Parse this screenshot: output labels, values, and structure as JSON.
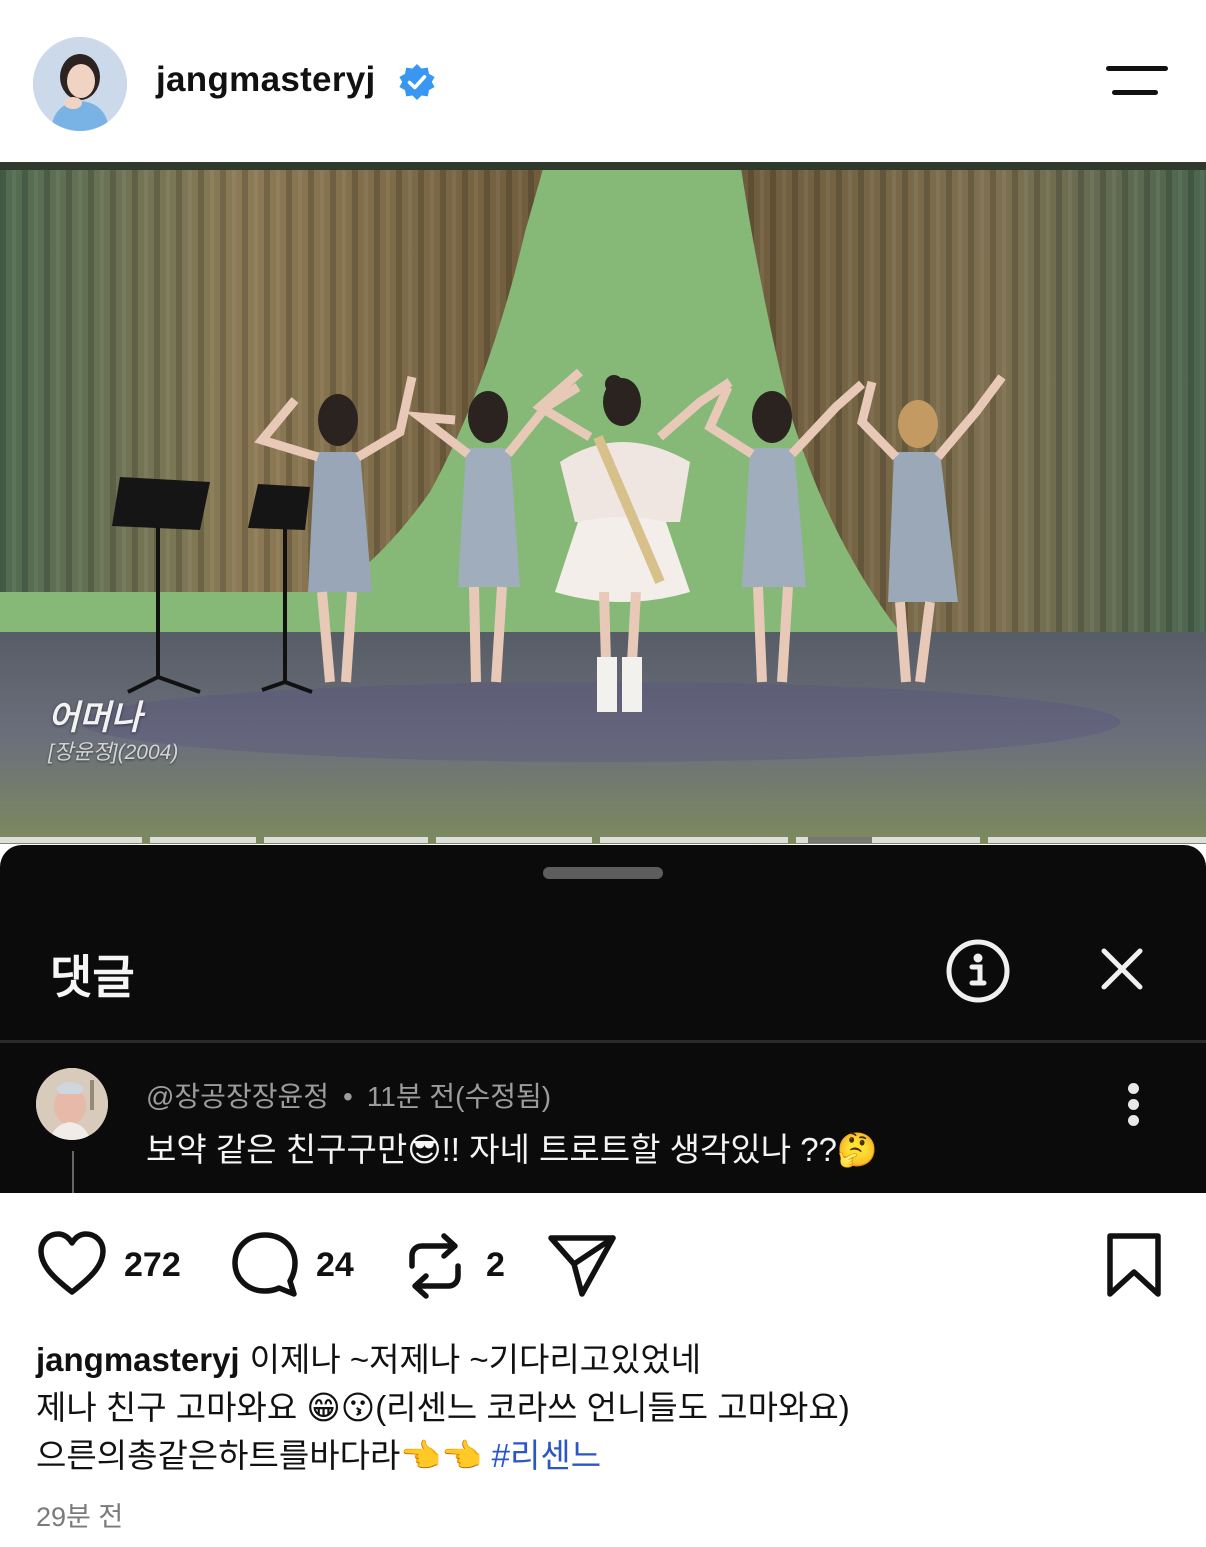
{
  "header": {
    "username": "jangmasteryj",
    "verified": true,
    "menu_icon": "menu-icon"
  },
  "media": {
    "caption_title": "어머나",
    "caption_subtitle": "[장윤정](2004)"
  },
  "comments_sheet": {
    "title": "댓글",
    "info_icon": "info-icon",
    "close_icon": "close-icon",
    "comment": {
      "author": "@장공장장윤정",
      "separator": "•",
      "time": "11분 전(수정됨)",
      "text": "보약 같은 친구구만😎!! 자네 트로트할 생각있나 ??🤔"
    }
  },
  "actions": {
    "like_count": "272",
    "comment_count": "24",
    "repost_count": "2"
  },
  "caption": {
    "username": "jangmasteryj",
    "line1": "이제나 ~저제나 ~기다리고있었네",
    "line2": "제나 친구 고마와요 😁😗(리센느 코라쓰 언니들도 고마와요)",
    "line3": "으른의총같은하트를바다라👈👈 ",
    "hashtag": "#리센느"
  },
  "timestamp": "29분 전",
  "colors": {
    "sheet_bg": "#0b0b0b",
    "verified_blue": "#3897f0",
    "hashtag_blue": "#2a56c6"
  }
}
